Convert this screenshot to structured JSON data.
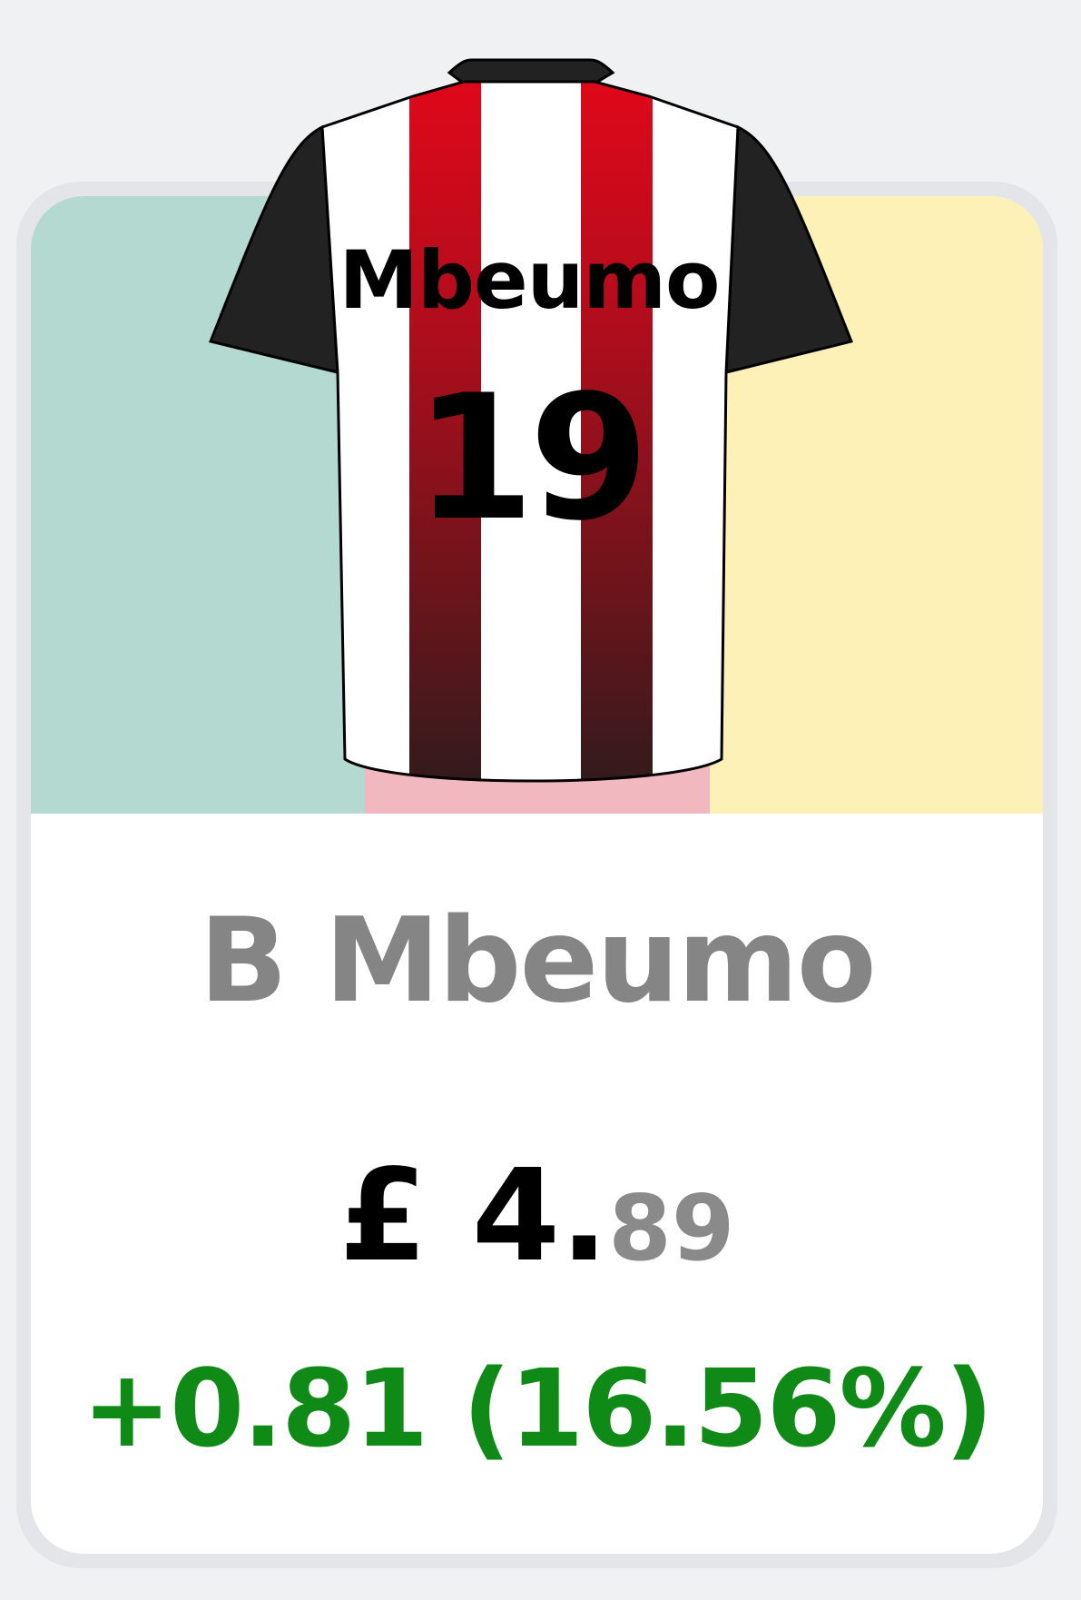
{
  "jersey": {
    "name": "Mbeumo",
    "number": "19",
    "stripe_color": "#e0081a",
    "sleeve_color": "#222222"
  },
  "panels": {
    "left_color": "#b3d9d1",
    "middle_color": "#f2b8bf",
    "right_color": "#fdf1b8"
  },
  "player": {
    "name": "B Mbeumo"
  },
  "price": {
    "main": "£ 4.",
    "decimal": "89"
  },
  "change": {
    "text": "+0.81 (16.56%)",
    "color": "#0f8a17"
  }
}
